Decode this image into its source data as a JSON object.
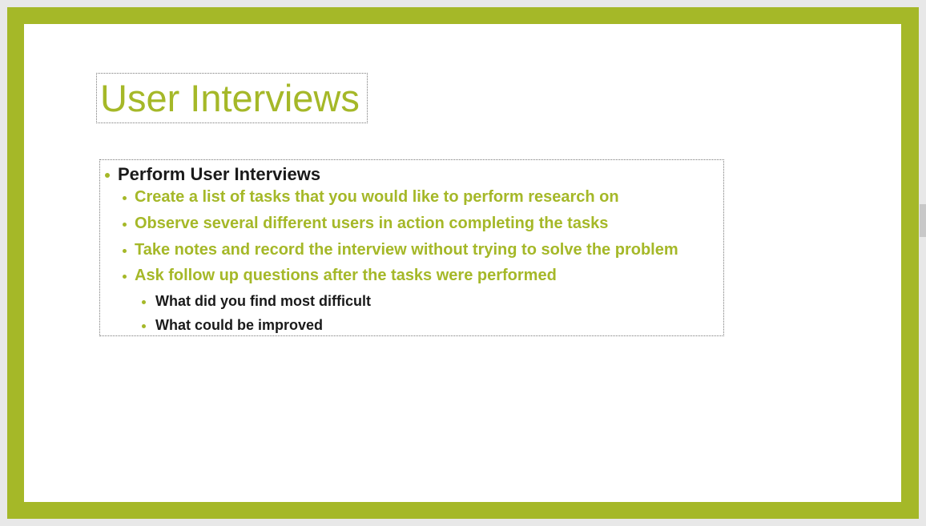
{
  "slide": {
    "title": "User Interviews",
    "bullets": {
      "level1": "Perform User Interviews",
      "level2": [
        "Create a list of tasks that you would like to perform research on",
        "Observe several different users in action completing the tasks",
        "Take notes and record the interview without trying to solve the problem",
        "Ask follow up questions after the tasks were performed"
      ],
      "level3": [
        "What did you find most difficult",
        "What could be improved"
      ]
    }
  },
  "colors": {
    "accent": "#a5b828",
    "text": "#1a1a1a",
    "background": "#ffffff"
  }
}
